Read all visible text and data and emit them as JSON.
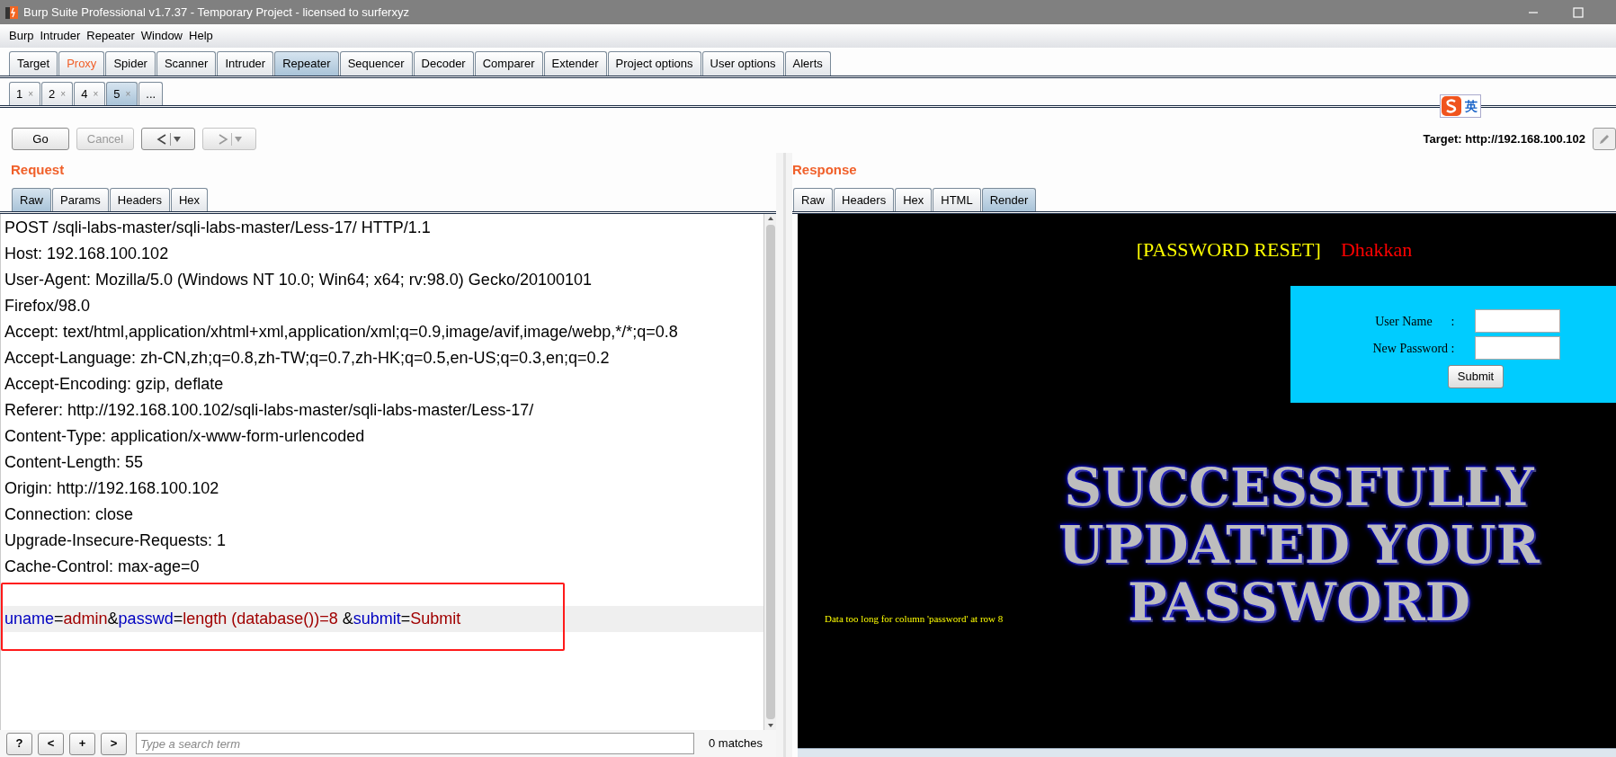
{
  "window": {
    "title": "Burp Suite Professional v1.7.37 - Temporary Project - licensed to surferxyz"
  },
  "menu": [
    "Burp",
    "Intruder",
    "Repeater",
    "Window",
    "Help"
  ],
  "tabs": [
    {
      "label": "Target",
      "selected": false,
      "highlighted": false
    },
    {
      "label": "Proxy",
      "selected": false,
      "highlighted": true
    },
    {
      "label": "Spider",
      "selected": false,
      "highlighted": false
    },
    {
      "label": "Scanner",
      "selected": false,
      "highlighted": false
    },
    {
      "label": "Intruder",
      "selected": false,
      "highlighted": false
    },
    {
      "label": "Repeater",
      "selected": true,
      "highlighted": false
    },
    {
      "label": "Sequencer",
      "selected": false,
      "highlighted": false
    },
    {
      "label": "Decoder",
      "selected": false,
      "highlighted": false
    },
    {
      "label": "Comparer",
      "selected": false,
      "highlighted": false
    },
    {
      "label": "Extender",
      "selected": false,
      "highlighted": false
    },
    {
      "label": "Project options",
      "selected": false,
      "highlighted": false
    },
    {
      "label": "User options",
      "selected": false,
      "highlighted": false
    },
    {
      "label": "Alerts",
      "selected": false,
      "highlighted": false
    }
  ],
  "repeater_tabs": [
    {
      "label": "1",
      "close": "×",
      "selected": false
    },
    {
      "label": "2",
      "close": "×",
      "selected": false
    },
    {
      "label": "4",
      "close": "×",
      "selected": false
    },
    {
      "label": "5",
      "close": "×",
      "selected": true
    },
    {
      "label": "..."
    }
  ],
  "ime": {
    "label": "英"
  },
  "toolbar": {
    "go": {
      "label": "Go",
      "disabled": false
    },
    "cancel": {
      "label": "Cancel",
      "disabled": true
    },
    "back": {
      "disabled": false
    },
    "forward": {
      "disabled": true
    },
    "target": "Target: http://192.168.100.102"
  },
  "request": {
    "title": "Request",
    "tabs": [
      {
        "label": "Raw",
        "selected": true
      },
      {
        "label": "Params",
        "selected": false
      },
      {
        "label": "Headers",
        "selected": false
      },
      {
        "label": "Hex",
        "selected": false
      }
    ],
    "lines": [
      "POST /sqli-labs-master/sqli-labs-master/Less-17/ HTTP/1.1",
      "Host: 192.168.100.102",
      "User-Agent: Mozilla/5.0 (Windows NT 10.0; Win64; x64; rv:98.0) Gecko/20100101",
      "Firefox/98.0",
      "Accept: text/html,application/xhtml+xml,application/xml;q=0.9,image/avif,image/webp,*/*;q=0.8",
      "Accept-Language: zh-CN,zh;q=0.8,zh-TW;q=0.7,zh-HK;q=0.5,en-US;q=0.3,en;q=0.2",
      "Accept-Encoding: gzip, deflate",
      "Referer: http://192.168.100.102/sqli-labs-master/sqli-labs-master/Less-17/",
      "Content-Type: application/x-www-form-urlencoded",
      "Content-Length: 55",
      "Origin: http://192.168.100.102",
      "Connection: close",
      "Upgrade-Insecure-Requests: 1",
      "Cache-Control: max-age=0"
    ],
    "body": [
      {
        "text": "uname",
        "kind": "name"
      },
      {
        "text": "=",
        "kind": "punct"
      },
      {
        "text": "admin",
        "kind": "value"
      },
      {
        "text": "&",
        "kind": "punct"
      },
      {
        "text": "passwd",
        "kind": "name"
      },
      {
        "text": "=",
        "kind": "punct"
      },
      {
        "text": "length (database())=8 ",
        "kind": "value"
      },
      {
        "text": "&",
        "kind": "punct"
      },
      {
        "text": "submit",
        "kind": "name"
      },
      {
        "text": "=",
        "kind": "punct"
      },
      {
        "text": "Submit",
        "kind": "value"
      }
    ],
    "search": {
      "buttons": [
        "?",
        "<",
        "+",
        ">"
      ],
      "placeholder": "Type a search term",
      "matches": "0 matches"
    }
  },
  "response": {
    "title": "Response",
    "tabs": [
      {
        "label": "Raw",
        "selected": false
      },
      {
        "label": "Headers",
        "selected": false
      },
      {
        "label": "Hex",
        "selected": false
      },
      {
        "label": "HTML",
        "selected": false
      },
      {
        "label": "Render",
        "selected": true
      }
    ],
    "render": {
      "heading": "[PASSWORD RESET]",
      "author": "Dhakkan",
      "fields": [
        {
          "label": "User Name      :"
        },
        {
          "label": "New Password :"
        }
      ],
      "submit": "Submit",
      "banner": [
        "SUCCESSFULLY",
        "UPDATED YOUR",
        "PASSWORD"
      ],
      "message": "Data too long for column 'password' at row 8"
    }
  }
}
